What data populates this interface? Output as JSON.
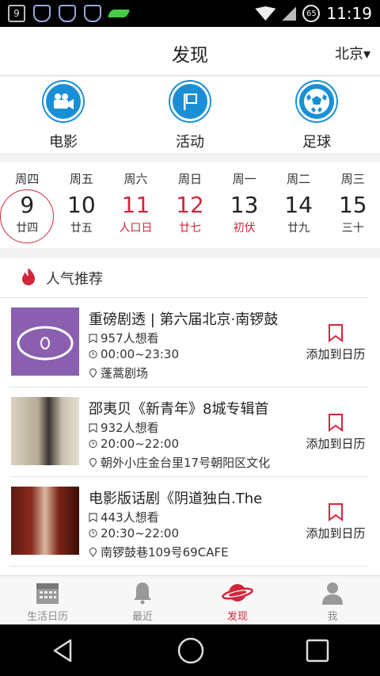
{
  "status_bar": {
    "time": "11:19",
    "notif_count": "9",
    "battery": "65"
  },
  "header": {
    "title": "发现",
    "city": "北京▾"
  },
  "categories": [
    {
      "label": "电影",
      "icon": "movie-camera-icon"
    },
    {
      "label": "活动",
      "icon": "flag-icon"
    },
    {
      "label": "足球",
      "icon": "soccer-ball-icon"
    }
  ],
  "days": [
    {
      "weekday": "周四",
      "date": "9",
      "lunar": "廿四",
      "selected": true,
      "red": false
    },
    {
      "weekday": "周五",
      "date": "10",
      "lunar": "廿五",
      "red": false
    },
    {
      "weekday": "周六",
      "date": "11",
      "lunar": "人口日",
      "red": true
    },
    {
      "weekday": "周日",
      "date": "12",
      "lunar": "廿七",
      "red": true
    },
    {
      "weekday": "周一",
      "date": "13",
      "lunar": "初伏",
      "lunar_red": true
    },
    {
      "weekday": "周二",
      "date": "14",
      "lunar": "廿九",
      "red": false
    },
    {
      "weekday": "周三",
      "date": "15",
      "lunar": "三十",
      "red": false
    }
  ],
  "feed": {
    "section_title": "人气推荐",
    "events": [
      {
        "title": "重磅剧透 | 第六届北京·南锣鼓",
        "wants": "957人想看",
        "time": "00:00~23:30",
        "venue": "蓬蒿剧场",
        "action": "添加到日历"
      },
      {
        "title": "邵夷贝《新青年》8城专辑首",
        "wants": "932人想看",
        "time": "20:00~22:00",
        "venue": "朝外小庄金台里17号朝阳区文化",
        "action": "添加到日历"
      },
      {
        "title": "电影版话剧《阴道独白.The",
        "wants": "443人想看",
        "time": "20:30~22:00",
        "venue": "南锣鼓巷109号69CAFE",
        "action": "添加到日历"
      }
    ]
  },
  "tabbar": [
    {
      "label": "生活日历",
      "icon": "calendar-icon",
      "active": false
    },
    {
      "label": "最近",
      "icon": "bell-icon",
      "active": false
    },
    {
      "label": "发现",
      "icon": "planet-icon",
      "active": true
    },
    {
      "label": "我",
      "icon": "person-icon",
      "active": false
    }
  ],
  "colors": {
    "accent": "#d0273b",
    "category_blue": "#1a8fd6"
  }
}
